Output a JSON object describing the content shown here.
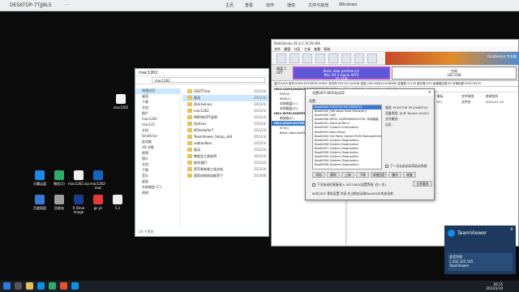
{
  "remote_bar": {
    "title": "DESKTOP-7TJJ8L5",
    "dots": "···",
    "tools": [
      "主页",
      "查看",
      "动作",
      "通信",
      "文件与其他",
      "Windows"
    ]
  },
  "desktop_icons_left": [
    {
      "label": "天翼云盘",
      "color": "#1e88e5"
    },
    {
      "label": "微信(2)",
      "color": "#2aae67"
    },
    {
      "label": "mac1262.zip",
      "color": "#eeeeee"
    },
    {
      "label": "mac1262-mac",
      "color": "#1565c0"
    },
    {
      "label": "TeamViewer",
      "color": "#0e8ee9"
    },
    {
      "label": "百度网盘",
      "color": "#3a78d6"
    },
    {
      "label": "回收站",
      "color": "#9e9e9e"
    },
    {
      "label": "R Drive Image",
      "color": "#1e3c8c"
    },
    {
      "label": "gc-yc",
      "color": "#e53935"
    },
    {
      "label": "5.2",
      "color": "#eeeeee"
    }
  ],
  "desktop_icon_mid": {
    "label": "mac1262"
  },
  "explorer": {
    "title": "mac1262",
    "address": "mac1262",
    "nav": [
      "快速访问",
      "桌面",
      "下载",
      "文档",
      "图片",
      "mac1262",
      "mac121",
      "文档",
      "OneDrive",
      "此电脑",
      "3D 对象",
      "视频",
      "图片",
      "文档",
      "下载",
      "音乐",
      "桌面",
      "本地磁盘 (C:)",
      "网络"
    ],
    "rows": [
      {
        "name": "SSDTTime",
        "date": "2022/4/"
      },
      {
        "name": "驱动",
        "date": "2022/4/"
      },
      {
        "name": "DiskGenius",
        "date": "2022/4/"
      },
      {
        "name": "mac1262",
        "date": "2022/4/"
      },
      {
        "name": "MBR转GPT说明",
        "date": "2022/4/"
      },
      {
        "name": "Options",
        "date": "2022/4/"
      },
      {
        "name": "KOInstaller7",
        "date": "2022/4/"
      },
      {
        "name": "TeamViewer_Setup_x64",
        "date": "2022/4/"
      },
      {
        "name": "usbtoolbox",
        "date": "2022/4/"
      },
      {
        "name": "驱动",
        "date": "2022/4/"
      },
      {
        "name": "教程及工具说明",
        "date": "2022/4/"
      },
      {
        "name": "联系我们",
        "date": "2022/4/"
      },
      {
        "name": "黑苹果安装工具文档",
        "date": "2022/4/"
      },
      {
        "name": "国家机构网站推荐下",
        "date": "2016/8/"
      }
    ],
    "status": "14 个项目"
  },
  "diskgenius": {
    "title": "DiskGenius V5.4.1.1178 x64",
    "menu": "文件 硬盘 分区 工具 查看 帮助",
    "banner_text": "DiskGenius 专业版",
    "disk_label": "磁盘 1",
    "disk_type": "GPT",
    "part1": {
      "line1": "Basic data partition(1)",
      "line2": "Mac OS X Apple APFS",
      "line3": "55.7GB"
    },
    "part2": {
      "line1": "空闲",
      "line2": "182.5GB"
    },
    "info_line": "接口:SATA 型号:ATAPLEXTORPX-256M7 序列号:P02741128436 容量:238.5GB(244198MB) 柱面数:31130 磁头数:255 每道扇区数:63 总扇区数:500118192",
    "tree": [
      {
        "text": "HD0:SAMSUNGMZVLW256HEHP-000L",
        "bold": true
      },
      {
        "text": "ESP(0)",
        "bold": false
      },
      {
        "text": "MSR(1)",
        "bold": false
      },
      {
        "text": "本地磁盘(C:)",
        "bold": false
      },
      {
        "text": "本地磁盘(D:)",
        "bold": false
      },
      {
        "text": "HD1:INTELSSDPEKKW010T8L-BSGAB-",
        "bold": true
      },
      {
        "text": "新加卷(E:)",
        "bold": false
      },
      {
        "text": "HD2:ATAPLEXTOR",
        "bold": true,
        "hl": true
      },
      {
        "text": "EFI(0)",
        "bold": false
      },
      {
        "text": "Basic data partiti",
        "bold": false
      }
    ],
    "tabs": "分区参数 浏览文件 扇区编辑",
    "table_headers": [
      "卷标",
      "序号(状态)",
      "文件系统",
      "标识",
      "起始柱面",
      "磁头",
      "扇区"
    ],
    "table_rows": [
      {
        "name": "EFI",
        "c2": "0",
        "fs": "FAT32",
        "flag": "",
        "start": "0",
        "head": "32",
        "sect": "33"
      },
      {
        "name": "Basic data partition(1)",
        "c2": "1",
        "fs": "APFS",
        "flag": "",
        "start": "26",
        "head": "",
        "sect": ""
      }
    ],
    "right_header": [
      "卷标",
      "文件系统",
      "修改时间"
    ],
    "right_rows": [
      {
        "name": "EFI",
        "fs": "文件夹",
        "time": "2023-01-10"
      }
    ]
  },
  "bios_dialog": {
    "title": "设置UEFI BIOS启动项",
    "section": "设置",
    "items": [
      {
        "text": "Boot0004 PLEXTOR PX-256M7VC",
        "hl": true
      },
      {
        "text": "Boot000E [Windows Boot Manager]"
      },
      {
        "text": "Boot000F USB"
      },
      {
        "text": "Boot0006 INTEL SSDPEKKW010T8L 本地磁盘"
      },
      {
        "text": "Boot0001 Startup Menu"
      },
      {
        "text": "Boot0002 System Information"
      },
      {
        "text": "Boot0003 Bios Setup"
      },
      {
        "text": "Boot0004 3rd Party Option ROM Management"
      },
      {
        "text": "Boot0005 System Diagnostics"
      },
      {
        "text": "Boot0006 System Diagnostics"
      },
      {
        "text": "Boot0007 System Diagnostics"
      },
      {
        "text": "Boot0008 System Diagnostics"
      },
      {
        "text": "Boot0009 System Diagnostics"
      },
      {
        "text": "Boot000A System Diagnostics"
      },
      {
        "text": "Boot000B System Diagnostics"
      }
    ],
    "props": [
      {
        "label": "描述:",
        "value": "PLEXTOR PX-256M7VC"
      },
      {
        "label": "设备类型:",
        "value": "ACPI Device (0x02)"
      },
      {
        "label": "文件路径:",
        "value": ""
      },
      {
        "label": "分区:",
        "value": ""
      }
    ],
    "btn_add": "添加",
    "btn_delete": "删除",
    "btn_up": "上移",
    "btn_down": "下移",
    "btn_detail": "详细信息",
    "btn_backup": "备份",
    "btn_restore": "恢复",
    "chk_next_boot": "下一次从此启动项启动系统",
    "chk_disable": "下次启动时直接进入 UEFI BIOS设置界面 (仅一次)",
    "btn_save": "立即重启",
    "footer": "64位UEFI  保存设置  关闭  在当前启动项Boot000E的启动前",
    "btn_ok": "确定",
    "btn_cancel": "关闭"
  },
  "teamviewer": {
    "name": "TeamViewer",
    "close": "×",
    "session_title": "会话列表",
    "session_id": "1 202 325 145",
    "session_sub": "TeamViewer",
    "minimize": "─"
  },
  "taskbar": {
    "time": "20:15",
    "date": "2023/1/10"
  }
}
